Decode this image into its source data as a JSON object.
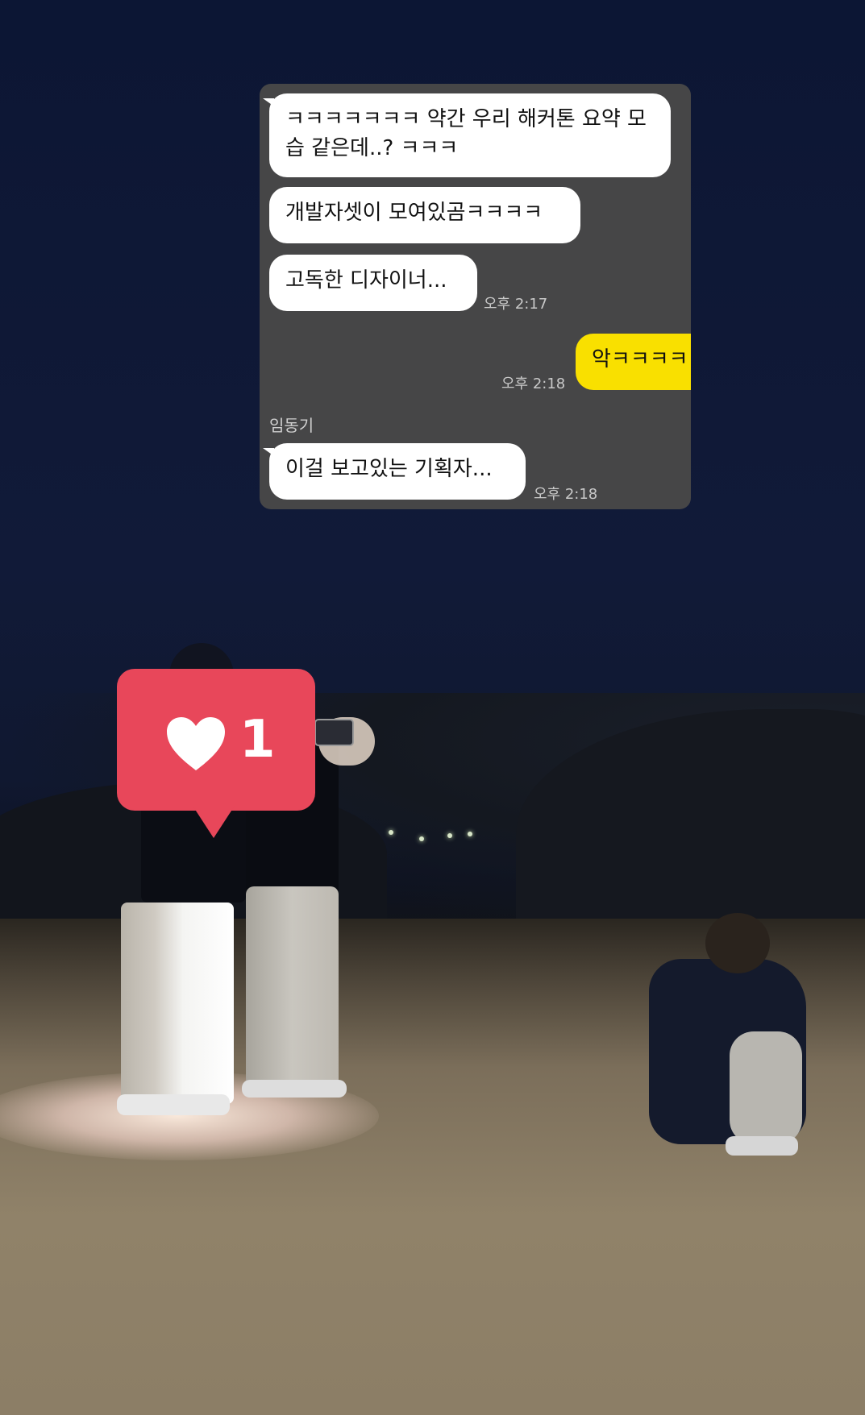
{
  "chat": {
    "messages": [
      {
        "text": "ㅋㅋㅋㅋㅋㅋㅋ 약간 우리 해커톤 요약 모습 같은데..? ㅋㅋㅋ",
        "side": "left"
      },
      {
        "text": "개발자셋이 모여있곰ㅋㅋㅋㅋ",
        "side": "left"
      },
      {
        "text": "고독한 디자이너...",
        "side": "left",
        "time": "오후 2:17"
      },
      {
        "text": "악ㅋㅋㅋㅋ",
        "side": "right",
        "time": "오후 2:18"
      },
      {
        "text": "이걸 보고있는 기획자...",
        "side": "left",
        "sender": "임동기",
        "time": "오후 2:18"
      }
    ]
  },
  "like_badge": {
    "icon": "heart-icon",
    "count": "1",
    "color": "#e8475a"
  },
  "colors": {
    "bubble_left": "#ffffff",
    "bubble_right": "#f9e000",
    "chat_bg": "#484848"
  }
}
